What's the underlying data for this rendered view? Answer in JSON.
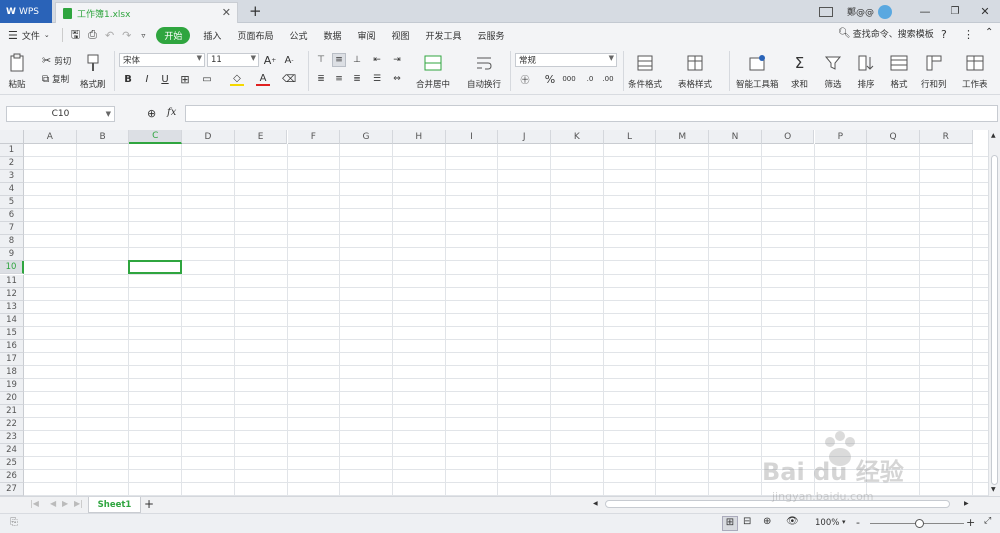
{
  "titlebar": {
    "app_tab": "WPS",
    "doc_tab": "工作簿1.xlsx",
    "user_name": "鄭@@",
    "colors": {
      "app_tab_bg": "#2a63b8",
      "brand_green": "#2fa53f"
    }
  },
  "menu": {
    "file": "文件",
    "tabs": [
      "开始",
      "插入",
      "页面布局",
      "公式",
      "数据",
      "审阅",
      "视图",
      "开发工具",
      "云服务"
    ],
    "active_tab": "开始",
    "search": "查找命令、搜索模板",
    "help": "?"
  },
  "ribbon": {
    "paste": "粘贴",
    "cut": "剪切",
    "copy": "复制",
    "format_painter": "格式刷",
    "font_name": "宋体",
    "font_size": "11",
    "bold": "B",
    "italic": "I",
    "underline": "U",
    "merge_center": "合并居中",
    "wrap_text": "自动换行",
    "number_format": "常规",
    "percent": "%",
    "thousands": "000",
    "cond_format": "条件格式",
    "table_style": "表格样式",
    "smart_toolbox": "智能工具箱",
    "sum": "求和",
    "filter": "筛选",
    "sort": "排序",
    "format": "格式",
    "row_col": "行和列",
    "worksheet": "工作表"
  },
  "formula_bar": {
    "name_box": "C10",
    "fx": "fx",
    "value": ""
  },
  "grid": {
    "columns": [
      "A",
      "B",
      "C",
      "D",
      "E",
      "F",
      "G",
      "H",
      "I",
      "J",
      "K",
      "L",
      "M",
      "N",
      "O",
      "P",
      "Q",
      "R"
    ],
    "rows": [
      "1",
      "2",
      "3",
      "4",
      "5",
      "6",
      "7",
      "8",
      "9",
      "10",
      "11",
      "12",
      "13",
      "14",
      "15",
      "16",
      "17",
      "18",
      "19",
      "20",
      "21",
      "22",
      "23",
      "24",
      "25",
      "26",
      "27"
    ],
    "active_column": "C",
    "active_row": "10",
    "colors": {
      "selection": "#2fa53f",
      "grid_line": "#e1e4e8"
    }
  },
  "sheets": {
    "tabs": [
      "Sheet1"
    ],
    "active": "Sheet1",
    "add": "+"
  },
  "status": {
    "zoom": "100%",
    "zoom_minus": "-",
    "zoom_plus": "+"
  },
  "watermark": {
    "brand": "Bai du 经验",
    "url": "jingyan.baidu.com"
  }
}
